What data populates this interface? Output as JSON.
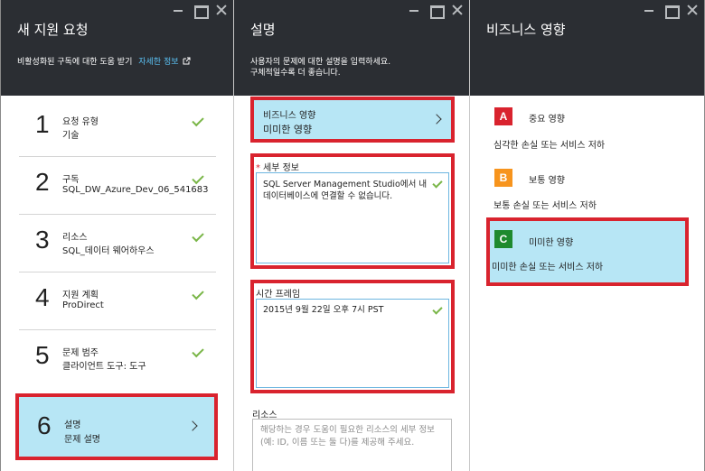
{
  "blade1": {
    "title": "새 지원 요청",
    "subtitle": "비활성화된 구독에 대한 도움 받기",
    "link": "자세한 정보",
    "steps": [
      {
        "num": "1",
        "label": "요청 유형",
        "value": "기술",
        "done": true
      },
      {
        "num": "2",
        "label": "구독",
        "value": "SQL_DW_Azure_Dev_06_541683",
        "done": true
      },
      {
        "num": "3",
        "label": "리소스",
        "value": "SQL_데이터 웨어하우스",
        "done": true
      },
      {
        "num": "4",
        "label": "지원 계획",
        "value": "ProDirect",
        "done": true
      },
      {
        "num": "5",
        "label": "문제 범주",
        "value": "클라이언트 도구: 도구",
        "done": true
      },
      {
        "num": "6",
        "label": "설명",
        "value": "문제 설명",
        "done": false
      }
    ]
  },
  "blade2": {
    "title": "설명",
    "subtitle_line1": "사용자의 문제에 대한 설명을 입력하세요.",
    "subtitle_line2": "구체적일수록 더 좋습니다.",
    "impact_label": "비즈니스 영향",
    "impact_value": "미미한 영향",
    "details_label": "세부 정보",
    "details_value": "SQL Server Management Studio에서 내 데이터베이스에 연결할 수 없습니다.",
    "timeframe_label": "시간 프레임",
    "timeframe_value": "2015년 9월 22일 오후 7시 PST",
    "resource_label": "리소스",
    "resource_placeholder": "해당하는 경우 도움이 필요한 리소스의 세부 정보(예: ID, 이름 또는 둘 다)를 제공해 주세요."
  },
  "blade3": {
    "title": "비즈니스 영향",
    "options": [
      {
        "badge": "A",
        "title": "중요 영향",
        "desc": "심각한 손실 또는 서비스 저하",
        "color": "#d9232e"
      },
      {
        "badge": "B",
        "title": "보통 영향",
        "desc": "보통 손실 또는 서비스 저하",
        "color": "#f7941d"
      },
      {
        "badge": "C",
        "title": "미미한 영향",
        "desc": "미미한 손실 또는 서비스 저하",
        "color": "#1e8a2e"
      }
    ]
  },
  "colors": {
    "header_bg": "#2b2e33",
    "selected_bg": "#b7e6f5",
    "highlight_frame": "#d9232e",
    "check": "#7ab648",
    "link": "#5bc2f5"
  }
}
